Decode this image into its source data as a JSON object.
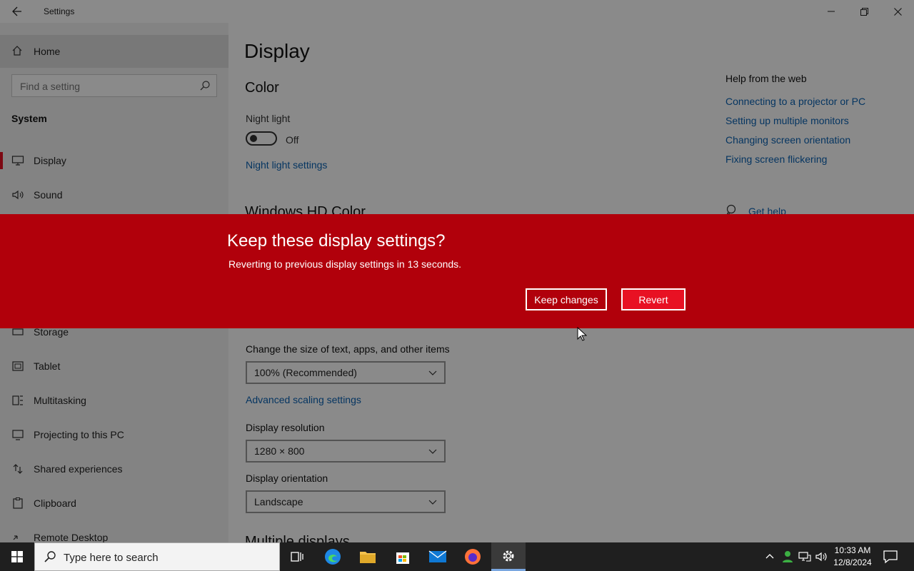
{
  "window": {
    "title": "Settings",
    "back_icon": "arrow-left-icon",
    "controls": [
      "minimize-icon",
      "restore-icon",
      "close-icon"
    ]
  },
  "sidebar": {
    "home_label": "Home",
    "search_placeholder": "Find a setting",
    "section_label": "System",
    "items": [
      {
        "label": "Display",
        "icon": "monitor-icon",
        "selected": true
      },
      {
        "label": "Sound",
        "icon": "speaker-icon",
        "selected": false
      },
      {
        "label": "Storage",
        "icon": "storage-icon",
        "selected": false
      },
      {
        "label": "Tablet",
        "icon": "tablet-icon",
        "selected": false
      },
      {
        "label": "Multitasking",
        "icon": "multitasking-icon",
        "selected": false
      },
      {
        "label": "Projecting to this PC",
        "icon": "projecting-icon",
        "selected": false
      },
      {
        "label": "Shared experiences",
        "icon": "shared-icon",
        "selected": false
      },
      {
        "label": "Clipboard",
        "icon": "clipboard-icon",
        "selected": false
      },
      {
        "label": "Remote Desktop",
        "icon": "remote-desktop-icon",
        "selected": false
      }
    ]
  },
  "main": {
    "title": "Display",
    "color_heading": "Color",
    "night_light_label": "Night light",
    "night_light_state": "Off",
    "night_light_settings_link": "Night light settings",
    "hdr_heading": "Windows HD Color",
    "scale_label": "Change the size of text, apps, and other items",
    "scale_value": "100% (Recommended)",
    "advanced_scaling_link": "Advanced scaling settings",
    "resolution_label": "Display resolution",
    "resolution_value": "1280 × 800",
    "orientation_label": "Display orientation",
    "orientation_value": "Landscape",
    "multiple_displays_heading": "Multiple displays"
  },
  "help": {
    "heading": "Help from the web",
    "links": [
      "Connecting to a projector or PC",
      "Setting up multiple monitors",
      "Changing screen orientation",
      "Fixing screen flickering"
    ],
    "get_help": "Get help"
  },
  "dialog": {
    "title": "Keep these display settings?",
    "message": "Reverting to previous display settings in 13 seconds.",
    "keep_label": "Keep changes",
    "revert_label": "Revert",
    "background_color": "#b1000b",
    "revert_color": "#e81123"
  },
  "taskbar": {
    "search_placeholder": "Type here to search",
    "apps": [
      "task-view-icon",
      "edge-icon",
      "file-explorer-icon",
      "store-icon",
      "mail-icon",
      "firefox-icon",
      "settings-gear-icon"
    ],
    "time": "10:33 AM",
    "date": "12/8/2024"
  }
}
